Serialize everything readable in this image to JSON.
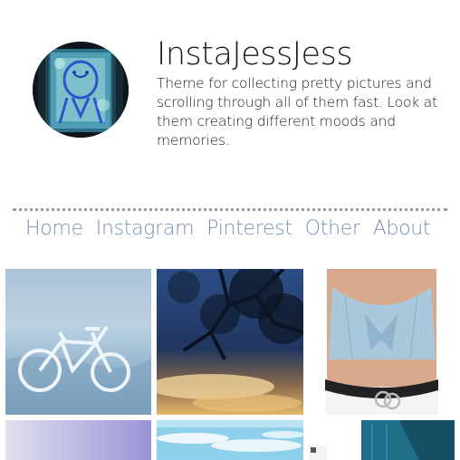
{
  "blog": {
    "title": "InstaJessJess",
    "description": "Theme for collecting pretty pictures and scrolling through all of them fast. Look at them creating different moods and memories."
  },
  "nav": {
    "items": [
      {
        "label": "Home"
      },
      {
        "label": "Instagram"
      },
      {
        "label": "Pinterest"
      },
      {
        "label": "Other"
      },
      {
        "label": "About"
      }
    ]
  },
  "colors": {
    "nav_link": "#7a92b0",
    "divider": "#9a9a9a",
    "text": "#1a1a1a"
  }
}
